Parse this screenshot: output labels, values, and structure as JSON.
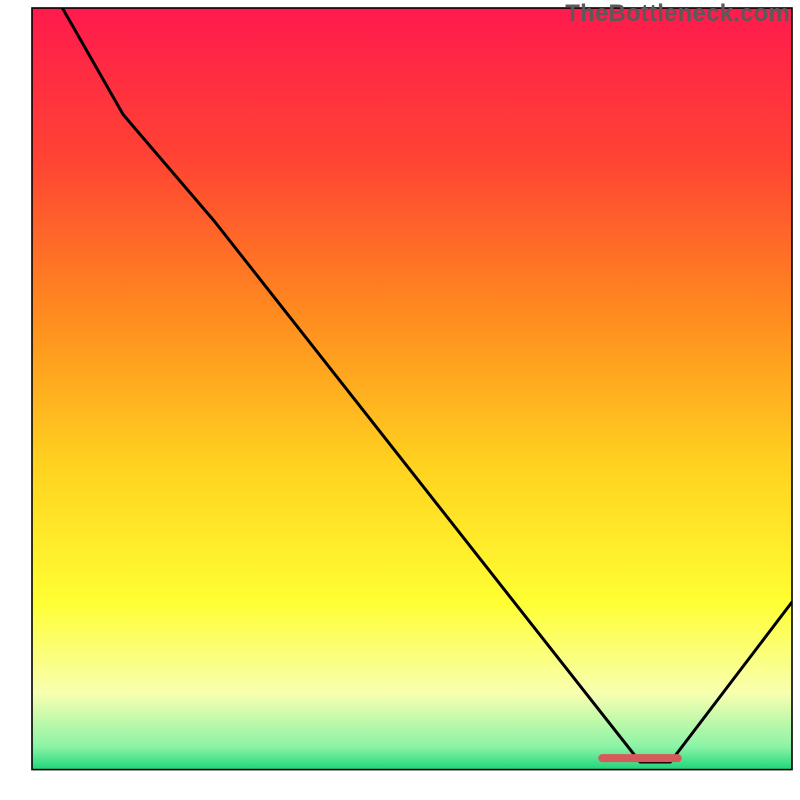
{
  "watermark": "TheBottleneck.com",
  "chart_data": {
    "type": "line",
    "title": "",
    "xlabel": "",
    "ylabel": "",
    "xlim": [
      0,
      100
    ],
    "ylim": [
      0,
      100
    ],
    "grid": false,
    "legend": false,
    "gradient_stops": [
      {
        "pos": 0.0,
        "color": "#ff1a4d"
      },
      {
        "pos": 0.2,
        "color": "#ff4433"
      },
      {
        "pos": 0.4,
        "color": "#ff8a1f"
      },
      {
        "pos": 0.6,
        "color": "#ffd21f"
      },
      {
        "pos": 0.78,
        "color": "#ffff33"
      },
      {
        "pos": 0.9,
        "color": "#f8ffb0"
      },
      {
        "pos": 0.97,
        "color": "#8bf3a6"
      },
      {
        "pos": 1.0,
        "color": "#1fd67a"
      }
    ],
    "series": [
      {
        "name": "bottleneck-curve",
        "x": [
          4.0,
          12.0,
          24.0,
          80.0,
          84.0,
          100.0
        ],
        "y": [
          100.0,
          86.0,
          72.0,
          1.0,
          1.0,
          22.0
        ]
      }
    ],
    "optimal_marker": {
      "x_start": 74.5,
      "x_end": 85.5,
      "y": 1.5,
      "color": "#d65a5a"
    },
    "frame": {
      "x0": 4.0,
      "y0": 3.8,
      "x1": 99.0,
      "y1": 99.0,
      "stroke": "#000000",
      "stroke_width": 1.6
    }
  }
}
